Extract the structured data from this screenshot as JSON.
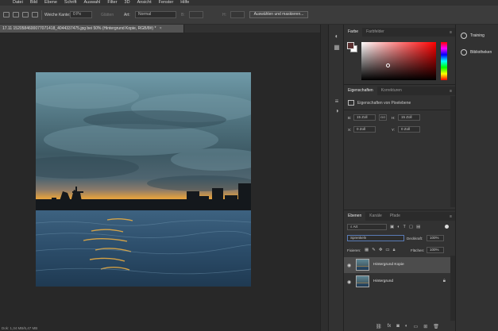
{
  "menu": [
    "Datei",
    "Bild",
    "Ebene",
    "Schrift",
    "Auswahl",
    "Filter",
    "3D",
    "Ansicht",
    "Fenster",
    "Hilfe"
  ],
  "options": {
    "soft_edge_label": "Weiche Kante:",
    "soft_edge_value": "0 Px",
    "antialias_label": "Glätten",
    "style_label": "Art:",
    "style_value": "Normal",
    "width_label": "B:",
    "height_label": "H:",
    "select_mask_button": "Auswählen und maskieren..."
  },
  "document": {
    "tab_title": "17.11 1520584600077071418_4044337475.jpg bei 50% (Hintergrund Kopie, RGB/8#) *",
    "close_glyph": "×",
    "status": "Dok: 1,34 MB/6,47 MB"
  },
  "color_panel": {
    "tabs": [
      "Farbe",
      "Farbfelder"
    ],
    "active_tab": "Farbe",
    "foreground_color": "#5a3030",
    "background_color": "#ffffff"
  },
  "properties_panel": {
    "tabs": [
      "Eigenschaften",
      "Korrekturen"
    ],
    "title": "Eigenschaften von Pixelebene",
    "w_label": "B:",
    "w_value": "15 Zoll",
    "h_label": "H:",
    "h_value": "15 Zoll",
    "link_label": "GO",
    "x_label": "X:",
    "x_value": "0 Zoll",
    "y_label": "Y:",
    "y_value": "0 Zoll"
  },
  "layers_panel": {
    "tabs": [
      "Ebenen",
      "Kanäle",
      "Pfade"
    ],
    "filter_value": "Art",
    "blend_mode": "Sprenkeln",
    "opacity_label": "Deckkraft:",
    "opacity_value": "100%",
    "lock_label": "Fixieren:",
    "fill_label": "Flächen:",
    "fill_value": "100%",
    "layers": [
      {
        "name": "Hintergrund Kopie",
        "selected": true,
        "locked": false
      },
      {
        "name": "Hintergrund",
        "selected": false,
        "locked": true
      }
    ]
  },
  "right_column": {
    "items": [
      "Training",
      "Bibliotheken"
    ]
  }
}
